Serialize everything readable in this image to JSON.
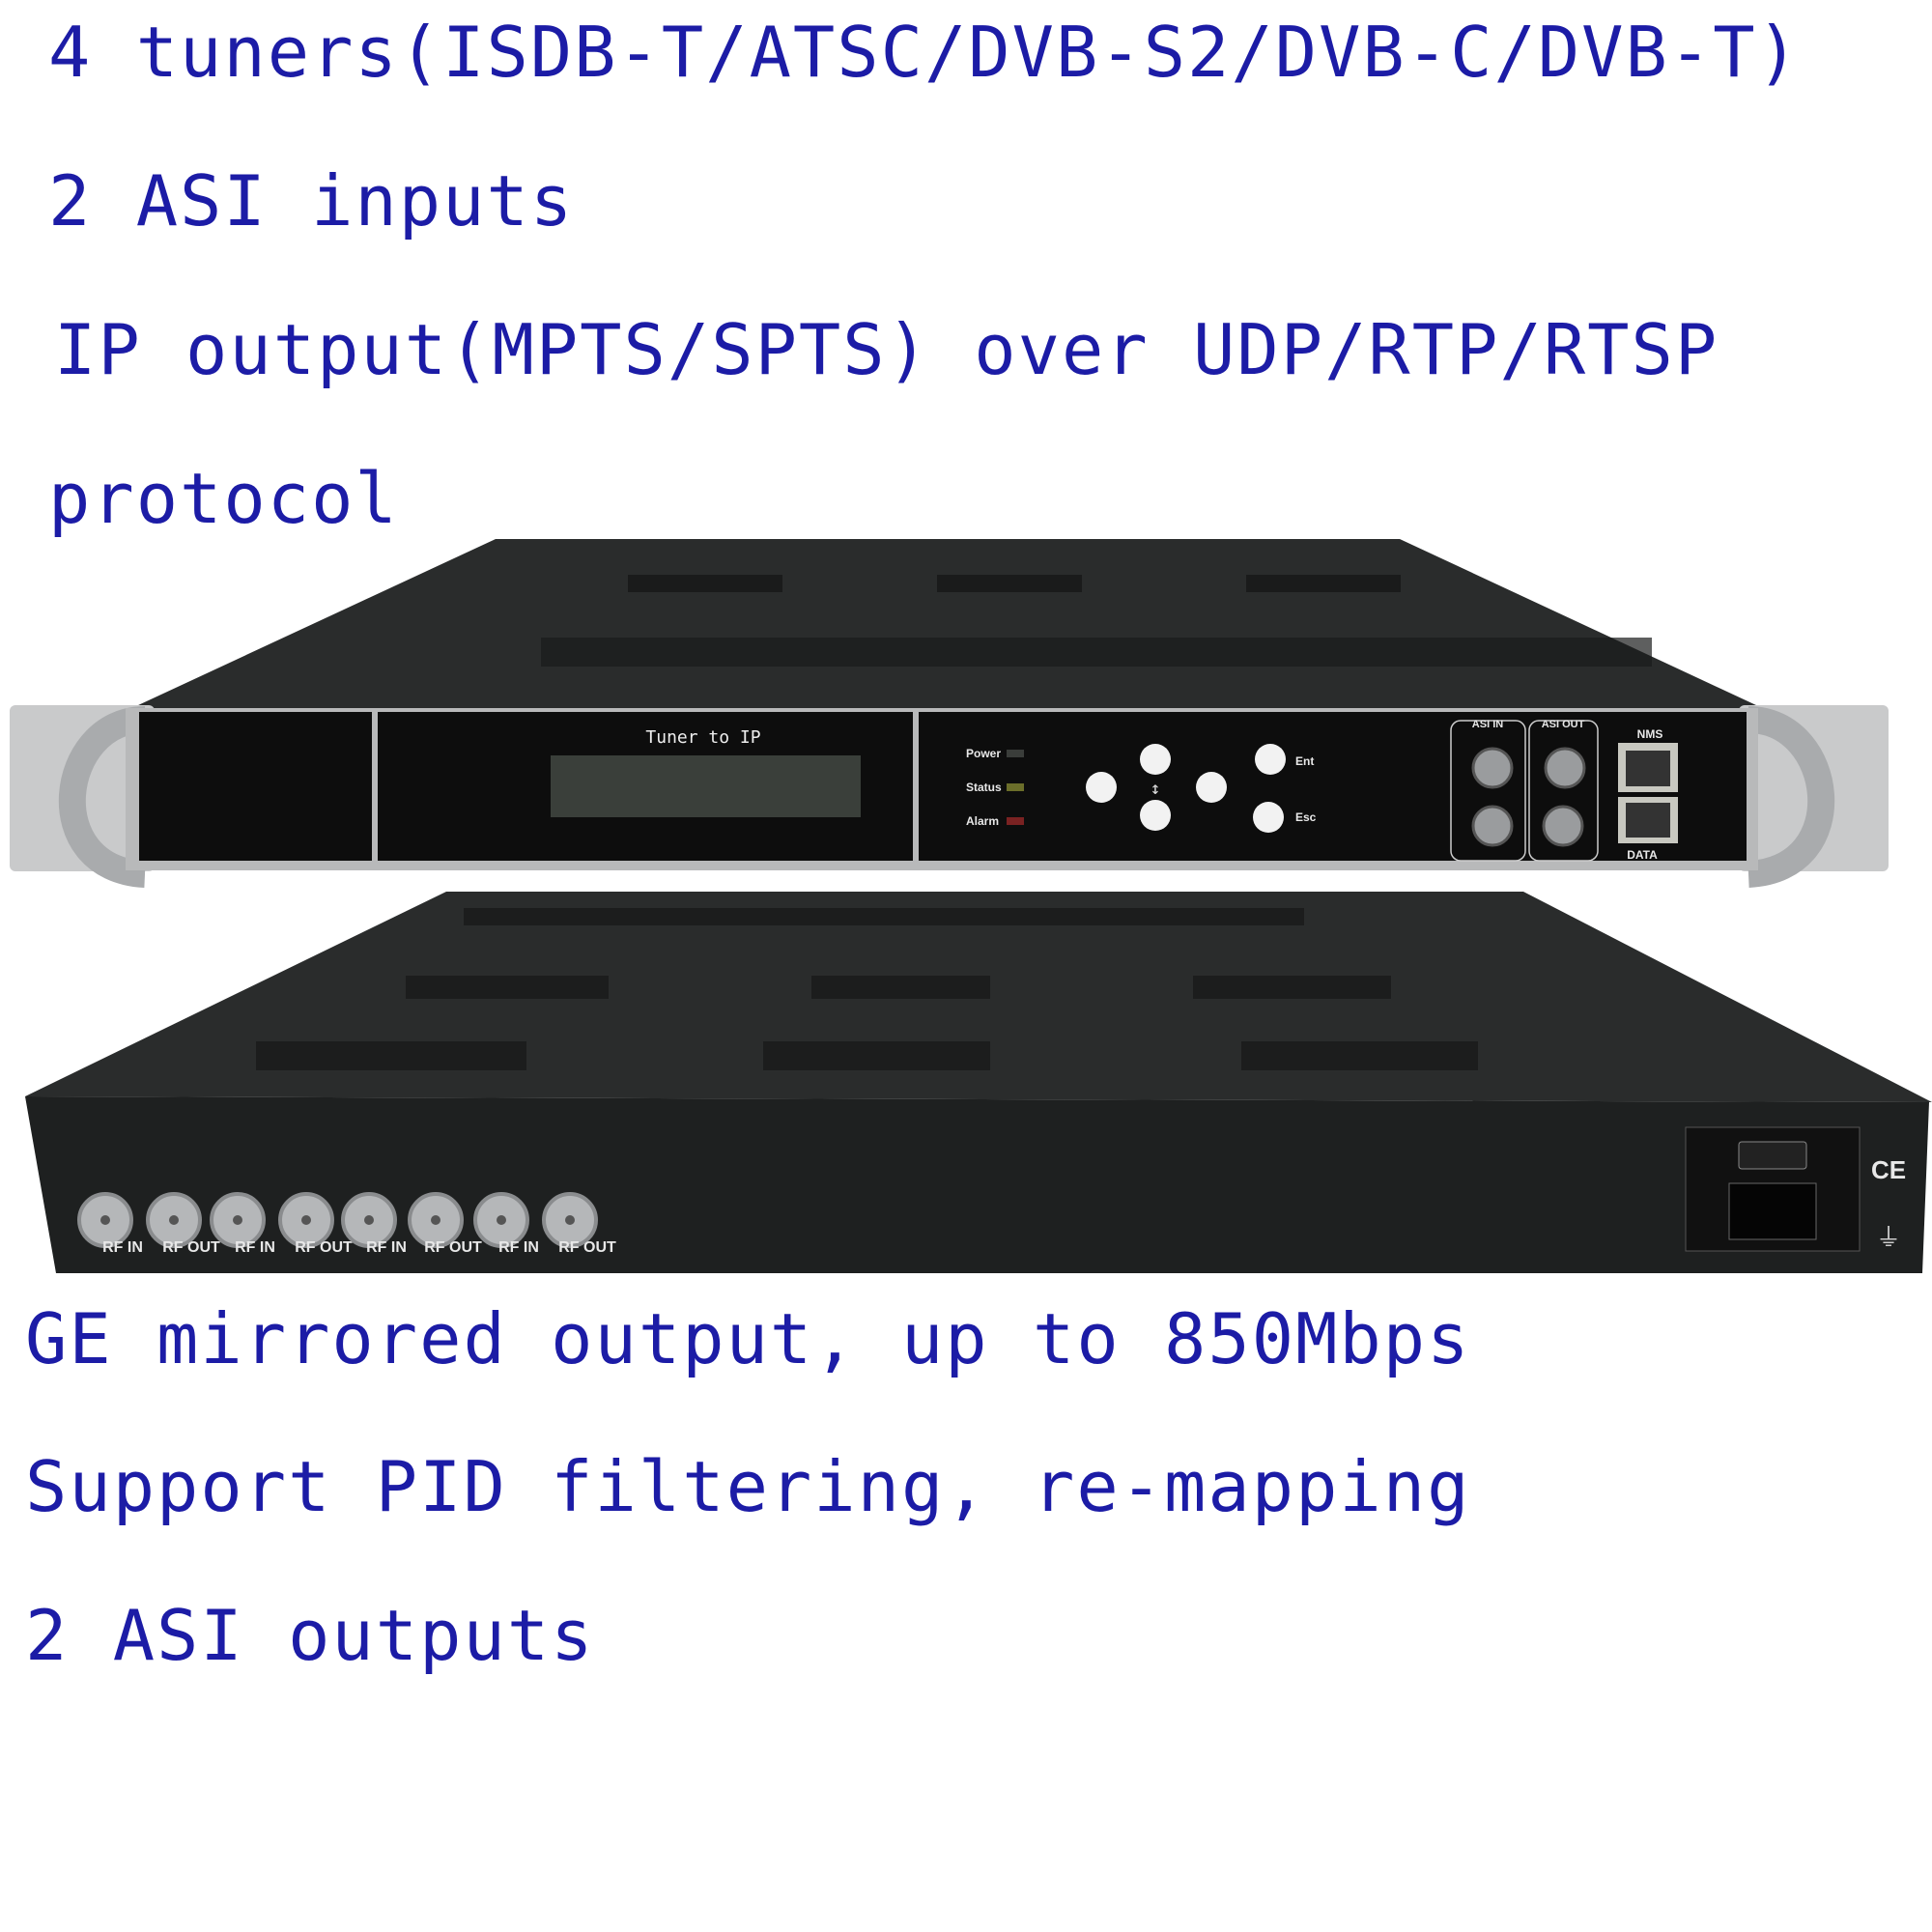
{
  "features_top": [
    "4 tuners(ISDB-T/ATSC/DVB-S2/DVB-C/DVB-T)",
    "2 ASI inputs",
    "IP output(MPTS/SPTS) over UDP/RTP/RTSP",
    "protocol"
  ],
  "features_bottom": [
    "GE mirrored output, up to 850Mbps",
    "Support PID filtering, re-mapping",
    "2 ASI outputs"
  ],
  "front_panel": {
    "lcd_title": "Tuner to IP",
    "leds": [
      {
        "label": "Power",
        "color": "#3a3d3a"
      },
      {
        "label": "Status",
        "color": "#6b6e2a"
      },
      {
        "label": "Alarm",
        "color": "#7a2222"
      }
    ],
    "buttons": {
      "enter": "Ent",
      "escape": "Esc"
    },
    "asi_in_label": "ASI IN",
    "asi_out_label": "ASI OUT",
    "nms_label": "NMS",
    "data_label": "DATA"
  },
  "rear_panel": {
    "rf_ports": [
      "RF IN",
      "RF OUT",
      "RF IN",
      "RF OUT",
      "RF IN",
      "RF OUT",
      "RF IN",
      "RF OUT"
    ],
    "certification": "CE"
  },
  "colors": {
    "text": "#1c1ca6",
    "chassis": "#1e2020",
    "panel": "#0d0d0d"
  }
}
